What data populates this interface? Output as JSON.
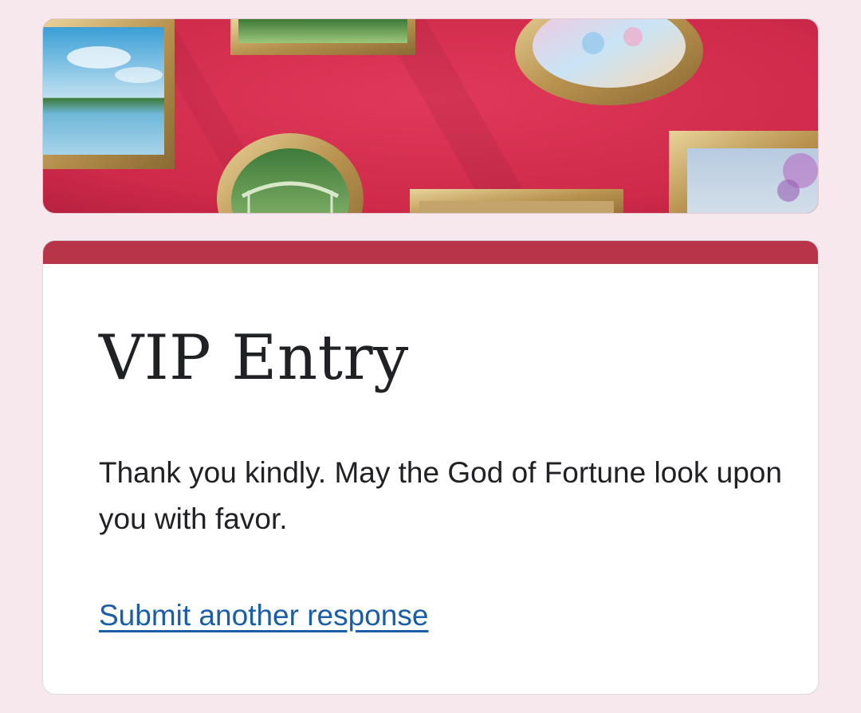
{
  "form": {
    "title": "VIP Entry",
    "confirmation_message": "Thank you kindly. May the God of Fortune look upon you with favor.",
    "submit_another_label": "Submit another response"
  },
  "colors": {
    "page_background": "#f6e8ec",
    "accent": "#b83448",
    "banner_wall": "#d8314f",
    "link": "#1a5ea8",
    "text": "#202124"
  },
  "banner": {
    "image": "gallery-wall-with-framed-paintings"
  }
}
